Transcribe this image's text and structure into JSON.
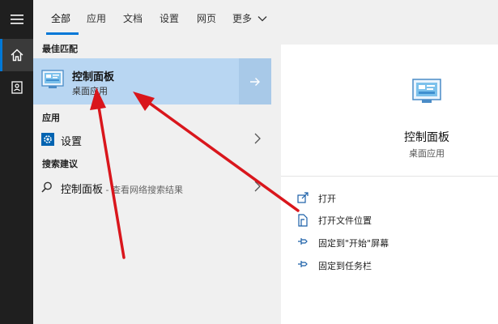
{
  "tabs": [
    {
      "label": "全部",
      "active": true
    },
    {
      "label": "应用"
    },
    {
      "label": "文档"
    },
    {
      "label": "设置"
    },
    {
      "label": "网页"
    },
    {
      "label": "更多"
    }
  ],
  "sections": {
    "best_match": "最佳匹配",
    "apps": "应用",
    "search_suggestions": "搜索建议"
  },
  "best_match": {
    "title": "控制面板",
    "subtitle": "桌面应用",
    "icon": "control-panel-icon"
  },
  "apps": [
    {
      "label": "设置",
      "icon": "gear-icon"
    }
  ],
  "suggestions": [
    {
      "label": "控制面板",
      "suffix": " - 查看网络搜索结果",
      "icon": "search-icon"
    }
  ],
  "detail": {
    "title": "控制面板",
    "subtitle": "桌面应用",
    "actions": [
      {
        "label": "打开",
        "icon": "open-icon"
      },
      {
        "label": "打开文件位置",
        "icon": "file-location-icon"
      },
      {
        "label": "固定到\"开始\"屏幕",
        "icon": "pin-icon"
      },
      {
        "label": "固定到任务栏",
        "icon": "pin-icon"
      }
    ]
  },
  "colors": {
    "accent": "#0078d7",
    "best_match_bg": "#b8d6f2",
    "annotation_arrow": "#d9161c"
  }
}
